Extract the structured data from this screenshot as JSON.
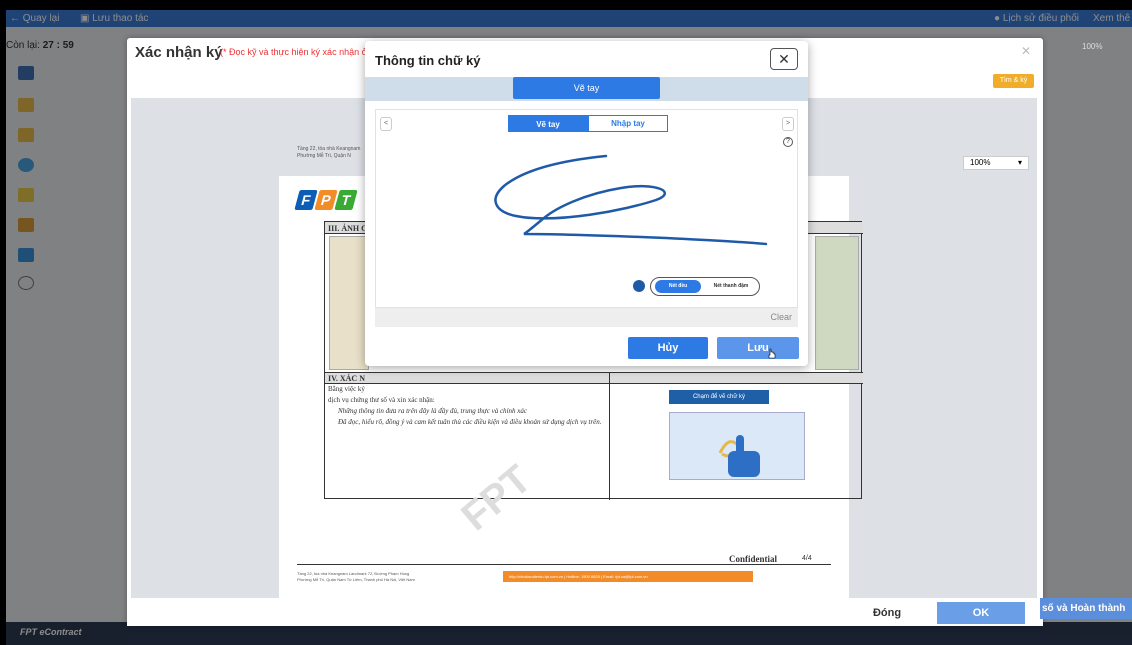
{
  "topbar": {
    "back": "← Quay lại",
    "save_flow": "Lưu thao tác",
    "history": "Lịch sử điều phối",
    "view": "Xem thê"
  },
  "timer": {
    "label": "Còn lại:",
    "value": "27 : 59"
  },
  "outer_dialog": {
    "title": "Xác nhận ký",
    "note": "(* Đọc kỹ và thực hiện ký xác nhận ở",
    "right_button": "Tìm & ký",
    "zoom": "100%",
    "zoom_top": "100%",
    "close_btn": "Đóng",
    "ok_btn": "OK",
    "finish_strip": "số và Hoàn thành"
  },
  "document": {
    "logo_letters": [
      "F",
      "P",
      "T"
    ],
    "header_address": "Tầng 22, tòa nhà Keangnam\nPhường Mễ Trì, Quận N",
    "section3": "III. ẢNH C",
    "section4": "IV. XÁC N",
    "section4_intro": "Bằng việc ký",
    "section4_text2": "dịch vụ chứng thư số và xin xác nhận:",
    "bullet1": "Những thông tin đưa ra trên đây là đầy đủ, trung thực và chính xác",
    "bullet2": "Đã đọc, hiểu rõ, đồng ý và cam kết tuân thủ các điều kiện và điều khoản sử dụng dịch vụ trên.",
    "sign_here": "Chạm để vẽ chữ ký",
    "confidential": "Confidential",
    "page_number": "4/4",
    "footer_address": "Tầng 22, tòa nhà Keangnam Landmark 72, Đường Phạm Hùng\nPhường Mễ Trì, Quận Nam Từ Liêm, Thành phố Hà Nội, Việt Nam",
    "footer_band": "http://chukisodientu.fpt.com.vn  |  Hotline: 1900 6625  |  Email: fpt.ca@fpt.com.vn",
    "watermark": "FPT"
  },
  "signature_dialog": {
    "title": "Thông tin chữ ký",
    "close_icon": "✕",
    "main_tab": "Vẽ tay",
    "subtab_draw": "Vẽ tay",
    "subtab_type": "Nhập tay",
    "prev": "<",
    "next": ">",
    "help": "?",
    "stroke_even": "Nét đều",
    "stroke_thin_thick": "Nét thanh đậm",
    "clear": "Clear",
    "cancel": "Hủy",
    "save": "Lưu",
    "ink_color": "#1e5aa8"
  },
  "bottombar": {
    "brand": "FPT eContract"
  }
}
